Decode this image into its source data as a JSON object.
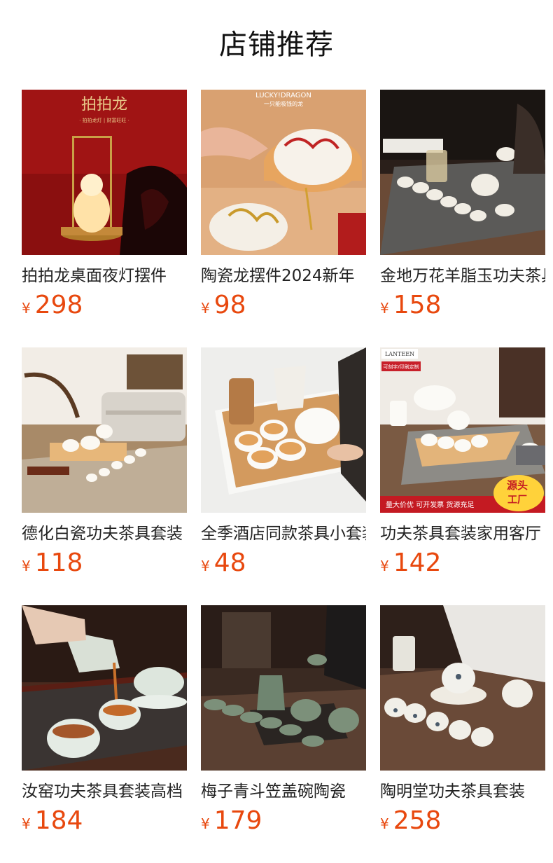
{
  "section": {
    "title": "店铺推荐"
  },
  "currency_symbol": "¥",
  "products": [
    {
      "name": "拍拍龙桌面夜灯摆件",
      "price": "298",
      "image_text": [
        "拍拍龙",
        "· 拍拍龙灯 | 财富旺旺 ·"
      ]
    },
    {
      "name": "陶瓷龙摆件2024新年",
      "price": "98",
      "image_text": [
        "LUCKY!DRAGON",
        "一只能吸钱的龙"
      ]
    },
    {
      "name": "金地万花羊脂玉功夫茶具",
      "price": "158",
      "image_text": []
    },
    {
      "name": "德化白瓷功夫茶具套装",
      "price": "118",
      "image_text": []
    },
    {
      "name": "全季酒店同款茶具小套装",
      "price": "48",
      "image_text": []
    },
    {
      "name": "功夫茶具套装家用客厅",
      "price": "142",
      "image_text": [
        "LANTEEN",
        "可刻字/印刷定制",
        "源头",
        "工厂",
        "量大价优 可开发票 货源充足"
      ]
    },
    {
      "name": "汝窑功夫茶具套装高档",
      "price": "184",
      "image_text": []
    },
    {
      "name": "梅子青斗笠盖碗陶瓷",
      "price": "179",
      "image_text": []
    },
    {
      "name": "陶明堂功夫茶具套装",
      "price": "258",
      "image_text": []
    }
  ],
  "colors": {
    "price": "#e8480e",
    "title": "#111111"
  }
}
